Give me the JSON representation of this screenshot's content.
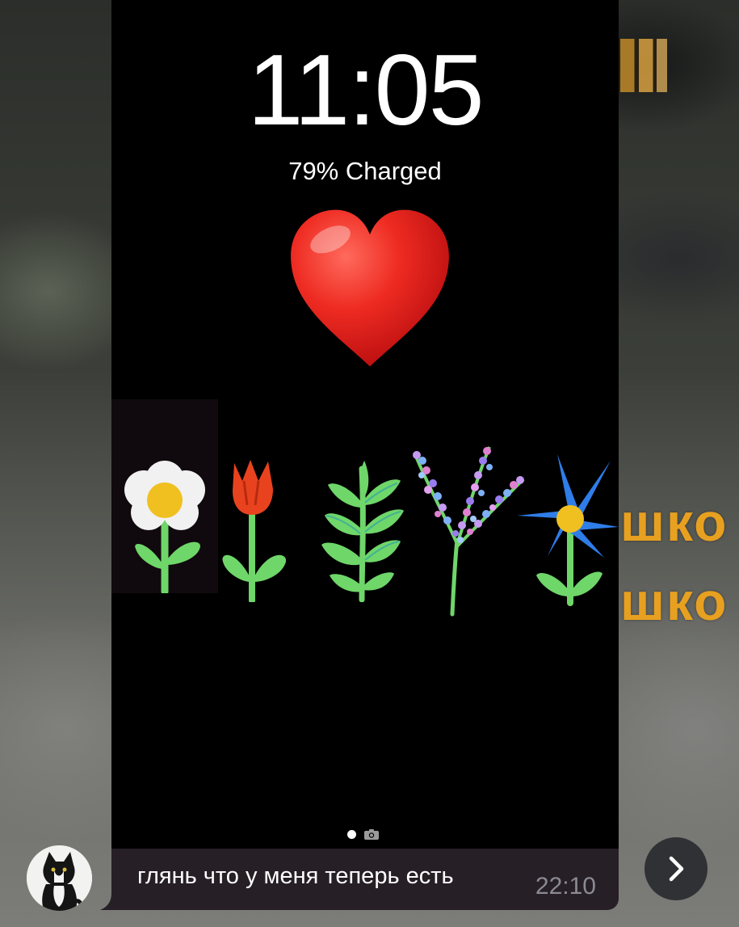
{
  "lockscreen": {
    "time": "11:05",
    "battery_status": "79% Charged"
  },
  "story": {
    "stickers": [
      "heart-emoji",
      "daisy",
      "tulip",
      "fern",
      "lavender",
      "blue-star-flower"
    ],
    "page_indicator": {
      "active": "dot",
      "other": "camera-icon"
    }
  },
  "background": {
    "sign_lines": [
      "шко",
      "шко"
    ]
  },
  "message": {
    "caption": "глянь что у меня теперь есть",
    "time": "22:10"
  },
  "navigation": {
    "next_icon": "chevron-right-icon"
  },
  "colors": {
    "caption_bg": "#271f26",
    "time_color": "#8a8a93",
    "heart": "#e8211f"
  }
}
